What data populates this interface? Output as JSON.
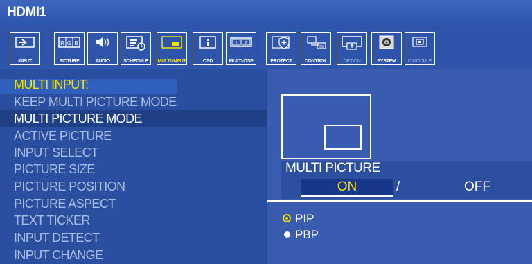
{
  "header": {
    "title": "HDMI1"
  },
  "toolbar": {
    "tabs": [
      {
        "label": "INPUT",
        "icon": "input-icon"
      },
      {
        "label": "PICTURE",
        "icon": "rgb-icon"
      },
      {
        "label": "AUDIO",
        "icon": "speaker-icon"
      },
      {
        "label": "SCHEDULE",
        "icon": "schedule-icon"
      },
      {
        "label": "MULTI-INPUT",
        "icon": "multi-input-icon",
        "active": true
      },
      {
        "label": "OSD",
        "icon": "info-icon"
      },
      {
        "label": "MULTI-DSP",
        "icon": "multi-display-icon"
      },
      {
        "label": "PROTECT",
        "icon": "shield-icon"
      },
      {
        "label": "CONTROL",
        "icon": "control-icon"
      },
      {
        "label": "OPTION",
        "icon": "option-icon",
        "dimmed": true
      },
      {
        "label": "SYSTEM",
        "icon": "system-icon"
      },
      {
        "label": "C MODULE",
        "icon": "compute-module-icon",
        "dimmed": true
      }
    ]
  },
  "menu": {
    "heading": "MULTI INPUT:",
    "items": [
      "KEEP MULTI PICTURE MODE",
      "MULTI PICTURE MODE",
      "ACTIVE PICTURE",
      "INPUT SELECT",
      "PICTURE SIZE",
      "PICTURE POSITION",
      "PICTURE ASPECT",
      "TEXT TICKER",
      "INPUT DETECT",
      "INPUT CHANGE"
    ],
    "selected_index": 1
  },
  "panel": {
    "label": "MULTI PICTURE",
    "on": "ON",
    "separator": "/",
    "off": "OFF",
    "selected": "ON",
    "options": [
      {
        "label": "PIP",
        "selected": true
      },
      {
        "label": "PBP",
        "selected": false
      }
    ]
  },
  "colors": {
    "highlight": "#f2e200",
    "background": "#2a4fa0",
    "text": "#ffffff",
    "dim_text": "#a9bde2"
  }
}
